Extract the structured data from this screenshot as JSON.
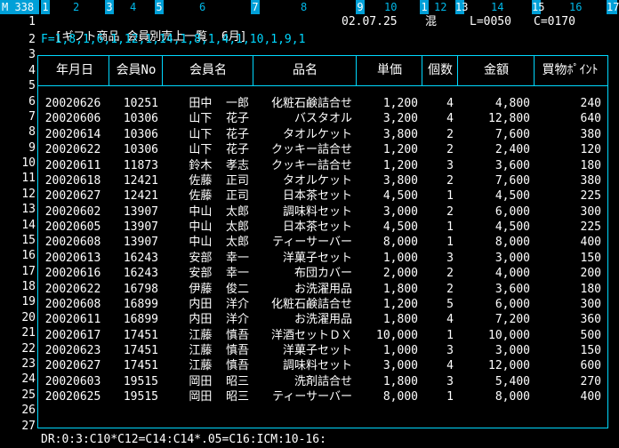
{
  "ruler": {
    "mode": "M 338",
    "markers": [
      "1",
      "2",
      "3",
      "4",
      "5",
      "6",
      "7",
      "8",
      "9",
      "10",
      "1",
      "12",
      "13",
      "14",
      "15",
      "16",
      "17"
    ]
  },
  "line_numbers": [
    "1",
    "2",
    "3",
    "4",
    "5",
    "6",
    "7",
    "8",
    "9",
    "10",
    "11",
    "12",
    "13",
    "14",
    "15",
    "16",
    "17",
    "18",
    "19",
    "20",
    "21",
    "22",
    "23",
    "24",
    "25",
    "26",
    "27"
  ],
  "title_line": {
    "title": "[ギフト商品 会員別売上一覧  6月]",
    "date": "02.07.25",
    "mode": "混",
    "line_pos": "L=0050",
    "col_pos": "C=0170"
  },
  "format_line": "F=1,8,1,6,1,12,1,14,1,8,1,4,1,10,1,9,1",
  "table": {
    "headers": [
      "年月日",
      "会員No",
      "会員名",
      "品名",
      "単価",
      "個数",
      "金額",
      "買物ﾎﾟｲﾝﾄ"
    ],
    "rows": [
      [
        "20020626",
        "10251",
        "田中  一郎",
        "化粧石鹸詰合せ",
        "1,200",
        "4",
        "4,800",
        "240"
      ],
      [
        "20020606",
        "10306",
        "山下  花子",
        "バスタオル",
        "3,200",
        "4",
        "12,800",
        "640"
      ],
      [
        "20020614",
        "10306",
        "山下  花子",
        "タオルケット",
        "3,800",
        "2",
        "7,600",
        "380"
      ],
      [
        "20020622",
        "10306",
        "山下  花子",
        "クッキー詰合せ",
        "1,200",
        "2",
        "2,400",
        "120"
      ],
      [
        "20020611",
        "11873",
        "鈴木  孝志",
        "クッキー詰合せ",
        "1,200",
        "3",
        "3,600",
        "180"
      ],
      [
        "20020618",
        "12421",
        "佐藤  正司",
        "タオルケット",
        "3,800",
        "2",
        "7,600",
        "380"
      ],
      [
        "20020627",
        "12421",
        "佐藤  正司",
        "日本茶セット",
        "4,500",
        "1",
        "4,500",
        "225"
      ],
      [
        "20020602",
        "13907",
        "中山  太郎",
        "調味料セット",
        "3,000",
        "2",
        "6,000",
        "300"
      ],
      [
        "20020605",
        "13907",
        "中山  太郎",
        "日本茶セット",
        "4,500",
        "1",
        "4,500",
        "225"
      ],
      [
        "20020608",
        "13907",
        "中山  太郎",
        "ティーサーバー",
        "8,000",
        "1",
        "8,000",
        "400"
      ],
      [
        "20020613",
        "16243",
        "安部  幸一",
        "洋菓子セット",
        "1,000",
        "3",
        "3,000",
        "150"
      ],
      [
        "20020616",
        "16243",
        "安部  幸一",
        "布団カバー",
        "2,000",
        "2",
        "4,000",
        "200"
      ],
      [
        "20020622",
        "16798",
        "伊藤  俊二",
        "お洗濯用品",
        "1,800",
        "2",
        "3,600",
        "180"
      ],
      [
        "20020608",
        "16899",
        "内田  洋介",
        "化粧石鹸詰合せ",
        "1,200",
        "5",
        "6,000",
        "300"
      ],
      [
        "20020611",
        "16899",
        "内田  洋介",
        "お洗濯用品",
        "1,800",
        "4",
        "7,200",
        "360"
      ],
      [
        "20020617",
        "17451",
        "江藤  慎吾",
        "洋酒セットＤＸ",
        "10,000",
        "1",
        "10,000",
        "500"
      ],
      [
        "20020623",
        "17451",
        "江藤  慎吾",
        "洋菓子セット",
        "1,000",
        "3",
        "3,000",
        "150"
      ],
      [
        "20020627",
        "17451",
        "江藤  慎吾",
        "調味料セット",
        "3,000",
        "4",
        "12,000",
        "600"
      ],
      [
        "20020603",
        "19515",
        "岡田  昭三",
        "洗剤詰合せ",
        "1,800",
        "3",
        "5,400",
        "270"
      ],
      [
        "20020625",
        "19515",
        "岡田  昭三",
        "ティーサーバー",
        "8,000",
        "1",
        "8,000",
        "400"
      ]
    ]
  },
  "status_line": "DR:0:3:C10*C12=C14:C14*.05=C16:ICM:10-16:"
}
